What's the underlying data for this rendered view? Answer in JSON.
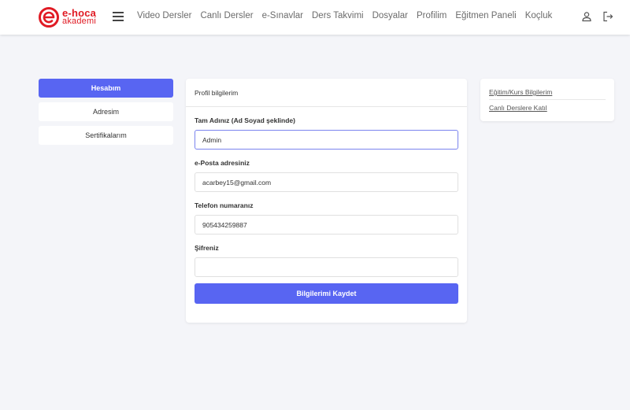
{
  "brand": {
    "line1": "e-hoca",
    "line2": "akademi",
    "color": "#e01b24"
  },
  "nav": {
    "items": [
      "Video Dersler",
      "Canlı Dersler",
      "e-Sınavlar",
      "Ders Takvimi",
      "Dosyalar",
      "Profilim",
      "Eğitmen Paneli",
      "Koçluk"
    ]
  },
  "header_icons": [
    "menu-icon",
    "user-icon",
    "logout-icon"
  ],
  "left_menu": {
    "items": [
      "Hesabım",
      "Adresim",
      "Sertifikalarım"
    ],
    "active_index": 0
  },
  "profile_card": {
    "title": "Profil bilgilerim",
    "fields": [
      {
        "label": "Tam Adınız (Ad Soyad şeklinde)",
        "value": "Admin"
      },
      {
        "label": "e-Posta adresiniz",
        "value": "acarbey15@gmail.com"
      },
      {
        "label": "Telefon numaranız",
        "value": "905434259887"
      },
      {
        "label": "Şifreniz",
        "value": ""
      }
    ],
    "submit_label": "Bilgilerimi Kaydet"
  },
  "side_links": [
    "Eğitim/Kurs Bilgilerim",
    "Canlı Derslere Katıl"
  ],
  "colors": {
    "accent": "#5865f2",
    "background": "#f4f5f9"
  }
}
